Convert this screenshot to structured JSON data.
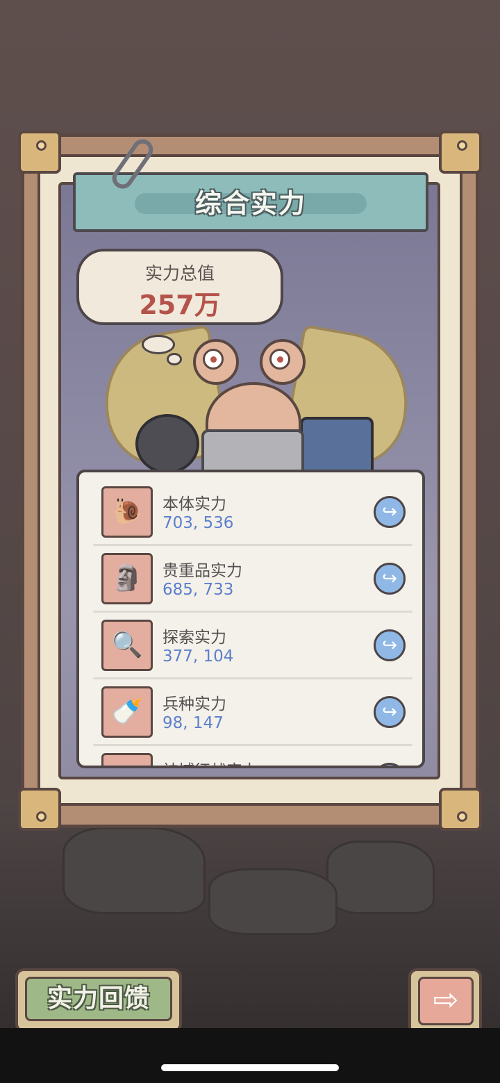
{
  "title": "综合实力",
  "total": {
    "label": "实力总值",
    "value": "257万"
  },
  "rows": [
    {
      "name": "本体实力",
      "value": "703, 536",
      "icon": "snail-icon",
      "glyph": "🐌"
    },
    {
      "name": "贵重品实力",
      "value": "685, 733",
      "icon": "statue-icon",
      "glyph": "🗿"
    },
    {
      "name": "探索实力",
      "value": "377, 104",
      "icon": "magnifier-map-icon",
      "glyph": "🔍"
    },
    {
      "name": "兵种实力",
      "value": "98, 147",
      "icon": "pacifier-icon",
      "glyph": "🍼"
    },
    {
      "name": "神域征战实力",
      "value": "",
      "icon": "partial-row-icon",
      "glyph": ""
    }
  ],
  "row_action_glyph": "↪",
  "buttons": {
    "feedback_label": "实力回馈",
    "next_glyph": "⇨"
  },
  "colors": {
    "value_blue": "#5b7fcc",
    "total_red": "#b5534a",
    "banner_teal": "#8dbcbb"
  }
}
